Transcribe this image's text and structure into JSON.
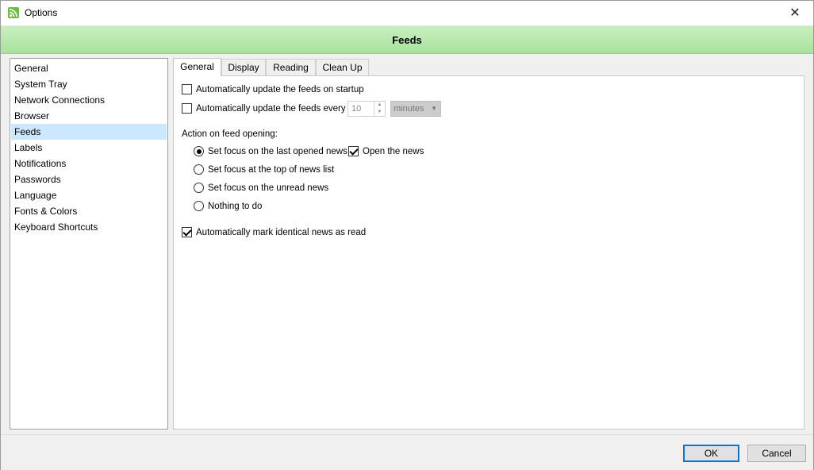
{
  "window": {
    "title": "Options",
    "close_glyph": "✕"
  },
  "banner": {
    "title": "Feeds"
  },
  "sidebar": {
    "items": [
      {
        "label": "General"
      },
      {
        "label": "System Tray"
      },
      {
        "label": "Network Connections"
      },
      {
        "label": "Browser"
      },
      {
        "label": "Feeds",
        "selected": true
      },
      {
        "label": "Labels"
      },
      {
        "label": "Notifications"
      },
      {
        "label": "Passwords"
      },
      {
        "label": "Language"
      },
      {
        "label": "Fonts & Colors"
      },
      {
        "label": "Keyboard Shortcuts"
      }
    ]
  },
  "tabs": [
    {
      "label": "General",
      "active": true
    },
    {
      "label": "Display"
    },
    {
      "label": "Reading"
    },
    {
      "label": "Clean Up"
    }
  ],
  "general": {
    "update_on_startup": {
      "label": "Automatically update the feeds on startup",
      "checked": false
    },
    "update_every": {
      "label": "Automatically update the feeds every",
      "checked": false,
      "interval_value": "10",
      "interval_unit": "minutes"
    },
    "action_label": "Action on feed opening:",
    "radios": [
      {
        "label": "Set focus on the last opened news",
        "checked": true
      },
      {
        "label": "Set focus at the top of news list",
        "checked": false
      },
      {
        "label": "Set focus on the unread news",
        "checked": false
      },
      {
        "label": "Nothing to do",
        "checked": false
      }
    ],
    "open_news": {
      "label": "Open the news",
      "checked": true
    },
    "mark_identical": {
      "label": "Automatically mark identical news as read",
      "checked": true
    }
  },
  "footer": {
    "ok_label": "OK",
    "cancel_label": "Cancel"
  },
  "colors": {
    "banner": "#b5e6aa",
    "selection": "#cce8ff",
    "default_button_border": "#0078d7",
    "app_icon": "#6cbf3b"
  }
}
